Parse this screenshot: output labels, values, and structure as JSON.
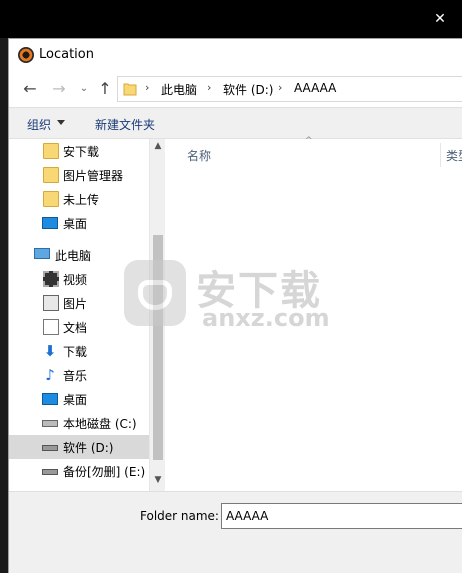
{
  "outer": {
    "close_glyph": "✕"
  },
  "dialog": {
    "title": "Location",
    "app_icon": "app-logo-icon"
  },
  "nav": {
    "back_glyph": "←",
    "forward_glyph": "→",
    "recent_glyph": "⌄",
    "up_glyph": "↑",
    "path": [
      "此电脑",
      "软件 (D:)",
      "AAAAA"
    ],
    "separator": "›"
  },
  "toolbar": {
    "organize_label": "组织",
    "new_folder_label": "新建文件夹"
  },
  "tree": {
    "items": [
      {
        "label": "安下载",
        "icon": "folder-icon"
      },
      {
        "label": "图片管理器",
        "icon": "folder-icon"
      },
      {
        "label": "未上传",
        "icon": "folder-icon"
      },
      {
        "label": "桌面",
        "icon": "desktop-icon"
      },
      {
        "label": "此电脑",
        "icon": "computer-icon"
      },
      {
        "label": "视频",
        "icon": "video-icon"
      },
      {
        "label": "图片",
        "icon": "pictures-icon"
      },
      {
        "label": "文档",
        "icon": "documents-icon"
      },
      {
        "label": "下载",
        "icon": "download-icon"
      },
      {
        "label": "音乐",
        "icon": "music-icon"
      },
      {
        "label": "桌面",
        "icon": "desktop-icon"
      },
      {
        "label": "本地磁盘 (C:)",
        "icon": "drive-c-icon"
      },
      {
        "label": "软件 (D:)",
        "icon": "drive-icon",
        "selected": true
      },
      {
        "label": "备份[勿删] (E:)",
        "icon": "drive-icon"
      }
    ],
    "scroll_up_glyph": "▲",
    "scroll_down_glyph": "▼"
  },
  "filelist": {
    "columns": [
      "名称",
      "类型"
    ],
    "sort_glyph": "^"
  },
  "bottom": {
    "folder_name_label": "Folder name:",
    "folder_name_value": "AAAAA"
  },
  "watermark": {
    "big_text": "安下载",
    "small_text": "anxz.com"
  },
  "colors": {
    "accent_link": "#1a3c78",
    "selection": "#d9d9d9",
    "header_text": "#4c607a"
  }
}
